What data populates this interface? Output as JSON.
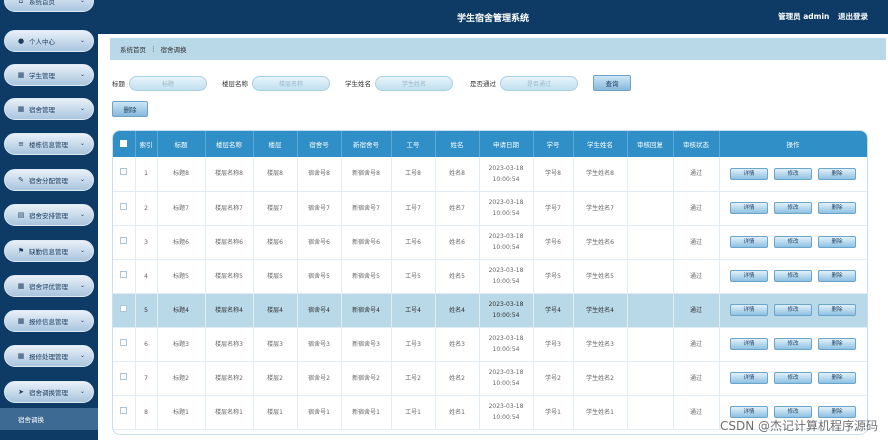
{
  "header": {
    "title": "学生宿舍管理系统",
    "user": "管理员 admin",
    "logout": "退出登录"
  },
  "sidebar": {
    "items": [
      {
        "label": "系统首页",
        "icon": "home-icon"
      },
      {
        "label": "个人中心",
        "icon": "user-icon"
      },
      {
        "label": "学生管理",
        "icon": "grid-icon"
      },
      {
        "label": "宿舍管理",
        "icon": "grid-icon"
      },
      {
        "label": "楼栋信息管理",
        "icon": "list-icon"
      },
      {
        "label": "宿舍分配管理",
        "icon": "edit-icon"
      },
      {
        "label": "宿舍安排管理",
        "icon": "doc-icon"
      },
      {
        "label": "缺勤信息管理",
        "icon": "flag-icon"
      },
      {
        "label": "宿舍评优管理",
        "icon": "grid-icon"
      },
      {
        "label": "报修信息管理",
        "icon": "grid-icon"
      },
      {
        "label": "报修处理管理",
        "icon": "grid-icon"
      },
      {
        "label": "宿舍调换管理",
        "icon": "send-icon"
      }
    ],
    "active": "宿舍调换"
  },
  "breadcrumb": {
    "home": "系统首页",
    "sep": "⋮",
    "current": "宿舍调换"
  },
  "search": {
    "fields": [
      {
        "label": "标题",
        "placeholder": "标题"
      },
      {
        "label": "楼层名称",
        "placeholder": "楼层名称"
      },
      {
        "label": "学生姓名",
        "placeholder": "学生姓名"
      },
      {
        "label": "是否通过",
        "placeholder": "是否通过"
      }
    ],
    "query_label": "查询",
    "delete_label": "删除"
  },
  "table": {
    "columns": [
      "索引",
      "标题",
      "楼层名称",
      "楼层",
      "宿舍号",
      "新宿舍号",
      "工号",
      "姓名",
      "申请日期",
      "学号",
      "学生姓名",
      "审核回复",
      "审核状态",
      "操作"
    ],
    "actions": [
      "详情",
      "修改",
      "删除"
    ],
    "rows": [
      {
        "idx": "1",
        "title": "标题8",
        "floor_name": "楼层名称8",
        "floor": "楼层8",
        "room": "宿舍号8",
        "new_room": "新宿舍号8",
        "emp_no": "工号8",
        "name": "姓名8",
        "date": "2023-03-18",
        "time": "10:00:54",
        "stu_no": "学号8",
        "stu_name": "学生姓名8",
        "reply": "",
        "status": "通过"
      },
      {
        "idx": "2",
        "title": "标题7",
        "floor_name": "楼层名称7",
        "floor": "楼层7",
        "room": "宿舍号7",
        "new_room": "新宿舍号7",
        "emp_no": "工号7",
        "name": "姓名7",
        "date": "2023-03-18",
        "time": "10:00:54",
        "stu_no": "学号7",
        "stu_name": "学生姓名7",
        "reply": "",
        "status": "通过"
      },
      {
        "idx": "3",
        "title": "标题6",
        "floor_name": "楼层名称6",
        "floor": "楼层6",
        "room": "宿舍号6",
        "new_room": "新宿舍号6",
        "emp_no": "工号6",
        "name": "姓名6",
        "date": "2023-03-18",
        "time": "10:00:54",
        "stu_no": "学号6",
        "stu_name": "学生姓名6",
        "reply": "",
        "status": "通过"
      },
      {
        "idx": "4",
        "title": "标题5",
        "floor_name": "楼层名称5",
        "floor": "楼层5",
        "room": "宿舍号5",
        "new_room": "新宿舍号5",
        "emp_no": "工号5",
        "name": "姓名5",
        "date": "2023-03-18",
        "time": "10:00:54",
        "stu_no": "学号5",
        "stu_name": "学生姓名5",
        "reply": "",
        "status": "通过"
      },
      {
        "idx": "5",
        "title": "标题4",
        "floor_name": "楼层名称4",
        "floor": "楼层4",
        "room": "宿舍号4",
        "new_room": "新宿舍号4",
        "emp_no": "工号4",
        "name": "姓名4",
        "date": "2023-03-18",
        "time": "10:00:54",
        "stu_no": "学号4",
        "stu_name": "学生姓名4",
        "reply": "",
        "status": "通过"
      },
      {
        "idx": "6",
        "title": "标题3",
        "floor_name": "楼层名称3",
        "floor": "楼层3",
        "room": "宿舍号3",
        "new_room": "新宿舍号3",
        "emp_no": "工号3",
        "name": "姓名3",
        "date": "2023-03-18",
        "time": "10:00:54",
        "stu_no": "学号3",
        "stu_name": "学生姓名3",
        "reply": "",
        "status": "通过"
      },
      {
        "idx": "7",
        "title": "标题2",
        "floor_name": "楼层名称2",
        "floor": "楼层2",
        "room": "宿舍号2",
        "new_room": "新宿舍号2",
        "emp_no": "工号2",
        "name": "姓名2",
        "date": "2023-03-18",
        "time": "10:00:54",
        "stu_no": "学号2",
        "stu_name": "学生姓名2",
        "reply": "",
        "status": "通过"
      },
      {
        "idx": "8",
        "title": "标题1",
        "floor_name": "楼层名称1",
        "floor": "楼层1",
        "room": "宿舍号1",
        "new_room": "新宿舍号1",
        "emp_no": "工号1",
        "name": "姓名1",
        "date": "2023-03-18",
        "time": "10:00:54",
        "stu_no": "学号1",
        "stu_name": "学生姓名1",
        "reply": "",
        "status": "通过"
      }
    ],
    "selected_row": 4
  },
  "watermark": "CSDN @杰记计算机程序源码"
}
